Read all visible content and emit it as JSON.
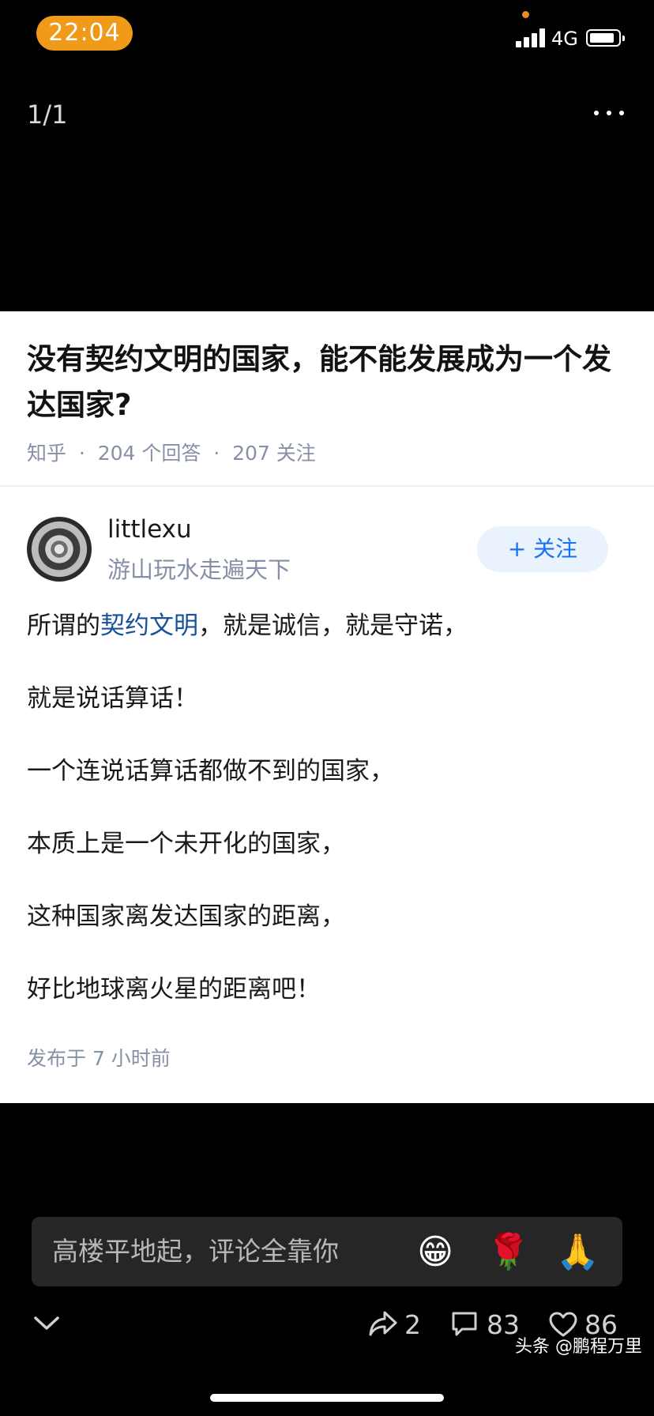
{
  "status_bar": {
    "time": "22:04",
    "network": "4G"
  },
  "viewer": {
    "page_counter": "1/1",
    "more_icon": "more-dots-icon"
  },
  "question": {
    "title": "没有契约文明的国家，能不能发展成为一个发达国家?",
    "meta": "知乎  ·  204 个回答  ·  207 关注"
  },
  "answer": {
    "author_name": "littlexu",
    "author_bio": "游山玩水走遍天下",
    "follow_label": "+ 关注",
    "first_line": {
      "prefix": "所谓的",
      "link": "契约文明",
      "suffix": "，就是诚信，就是守诺，"
    },
    "paragraphs": [
      "就是说话算话！",
      "一个连说话算话都做不到的国家，",
      "本质上是一个未开化的国家，",
      "这种国家离发达国家的距离，",
      "好比地球离火星的距离吧！"
    ],
    "published": "发布于 7 小时前"
  },
  "comment_bar": {
    "placeholder": "高楼平地起，评论全靠你",
    "emojis": [
      "😁",
      "🌹",
      "🙏"
    ]
  },
  "actions": {
    "share_count": "2",
    "comment_count": "83",
    "like_count": "86"
  },
  "watermark": "头条 @鹏程万里",
  "colors": {
    "time_pill": "#f09a19",
    "link": "#175199",
    "follow_text": "#1772f6",
    "meta_gray": "#8590a6"
  }
}
